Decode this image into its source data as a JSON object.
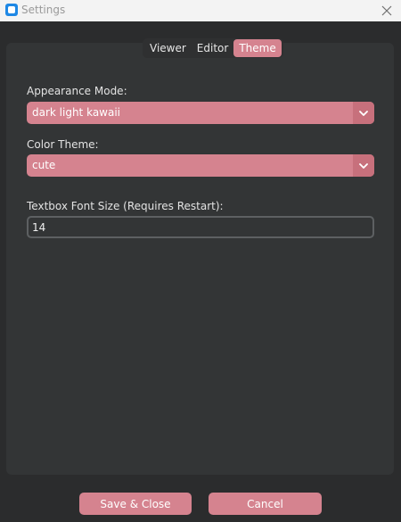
{
  "window": {
    "title": "Settings"
  },
  "tabs": [
    {
      "label": "Viewer"
    },
    {
      "label": "Editor"
    },
    {
      "label": "Theme"
    }
  ],
  "active_tab": "Theme",
  "form": {
    "appearance_mode_label": "Appearance Mode:",
    "appearance_mode_value": "dark light kawaii",
    "color_theme_label": "Color Theme:",
    "color_theme_value": "cute",
    "font_size_label": "Textbox Font Size (Requires Restart):",
    "font_size_value": "14"
  },
  "buttons": {
    "save_label": "Save & Close",
    "cancel_label": "Cancel"
  },
  "colors": {
    "accent": "#d5838f",
    "accent_dark": "#c7707c",
    "panel": "#333536",
    "background": "#2b2c2d"
  },
  "icons": {
    "app": "app-icon",
    "close": "close-icon",
    "dropdown": "chevron-down-icon"
  }
}
